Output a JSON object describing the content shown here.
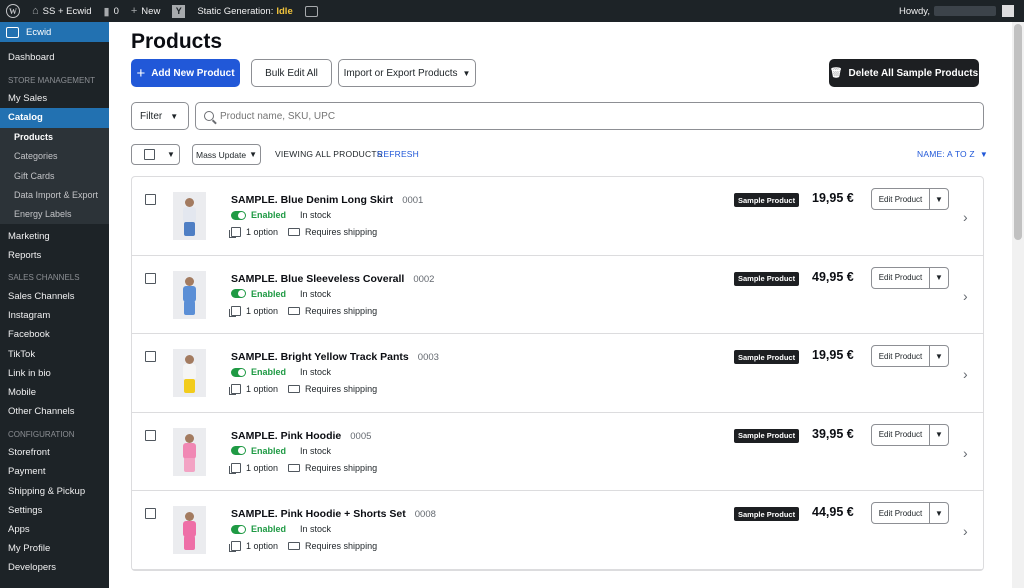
{
  "adminbar": {
    "site_name": "SS + Ecwid",
    "comments_count": "0",
    "new_label": "New",
    "yoast_glyph": "Y",
    "static_gen_label": "Static Generation:",
    "static_gen_status": "Idle",
    "howdy": "Howdy,"
  },
  "sidebar": {
    "brand": "Ecwid",
    "dashboard": "Dashboard",
    "section_store": "STORE MANAGEMENT",
    "my_sales": "My Sales",
    "catalog": "Catalog",
    "catalog_sub": [
      "Products",
      "Categories",
      "Gift Cards",
      "Data Import & Export",
      "Energy Labels"
    ],
    "marketing": "Marketing",
    "reports": "Reports",
    "section_channels": "SALES CHANNELS",
    "channels": [
      "Sales Channels",
      "Instagram",
      "Facebook",
      "TikTok",
      "Link in bio",
      "Mobile",
      "Other Channels"
    ],
    "section_config": "CONFIGURATION",
    "config": [
      "Storefront",
      "Payment",
      "Shipping & Pickup",
      "Settings",
      "Apps",
      "My Profile",
      "Developers"
    ]
  },
  "page": {
    "title": "Products",
    "add_button": "Add New Product",
    "bulk_button": "Bulk Edit All",
    "import_button": "Import or Export Products",
    "delete_button": "Delete All Sample Products",
    "filter_label": "Filter",
    "search_placeholder": "Product name, SKU, UPC",
    "mass_update": "Mass Update",
    "viewing": "VIEWING ALL PRODUCTS",
    "refresh": "REFRESH",
    "sort": "NAME: A TO Z"
  },
  "products": [
    {
      "name": "SAMPLE. Blue Denim Long Skirt",
      "sku": "0001",
      "status": "Enabled",
      "stock": "In stock",
      "options": "1 option",
      "shipping": "Requires shipping",
      "badge": "Sample Product",
      "price": "19,95 €",
      "edit": "Edit Product",
      "colors": {
        "top": "#e3e7ef",
        "bottom": "#4f7fc4"
      }
    },
    {
      "name": "SAMPLE. Blue Sleeveless Coverall",
      "sku": "0002",
      "status": "Enabled",
      "stock": "In stock",
      "options": "1 option",
      "shipping": "Requires shipping",
      "badge": "Sample Product",
      "price": "49,95 €",
      "edit": "Edit Product",
      "colors": {
        "top": "#5b8fd6",
        "bottom": "#5b8fd6"
      }
    },
    {
      "name": "SAMPLE. Bright Yellow Track Pants",
      "sku": "0003",
      "status": "Enabled",
      "stock": "In stock",
      "options": "1 option",
      "shipping": "Requires shipping",
      "badge": "Sample Product",
      "price": "19,95 €",
      "edit": "Edit Product",
      "colors": {
        "top": "#f5f5f5",
        "bottom": "#f2cc1c"
      }
    },
    {
      "name": "SAMPLE. Pink Hoodie",
      "sku": "0005",
      "status": "Enabled",
      "stock": "In stock",
      "options": "1 option",
      "shipping": "Requires shipping",
      "badge": "Sample Product",
      "price": "39,95 €",
      "edit": "Edit Product",
      "colors": {
        "top": "#f088b4",
        "bottom": "#f3a3c4"
      }
    },
    {
      "name": "SAMPLE. Pink Hoodie + Shorts Set",
      "sku": "0008",
      "status": "Enabled",
      "stock": "In stock",
      "options": "1 option",
      "shipping": "Requires shipping",
      "badge": "Sample Product",
      "price": "44,95 €",
      "edit": "Edit Product",
      "colors": {
        "top": "#ee6fa7",
        "bottom": "#ee6fa7"
      }
    }
  ]
}
